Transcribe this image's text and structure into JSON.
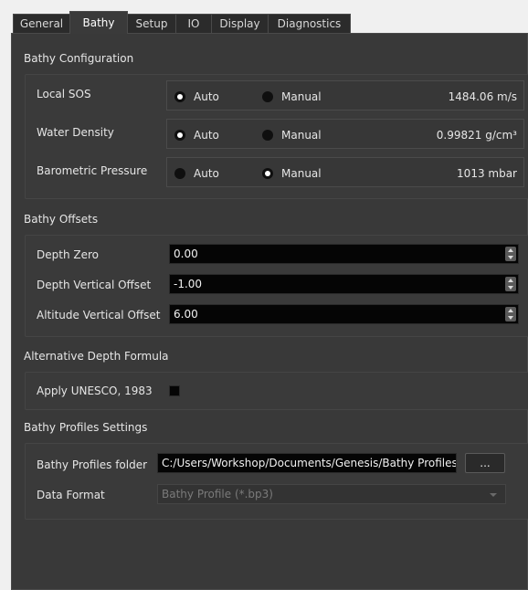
{
  "tabs": [
    "General",
    "Bathy",
    "Setup",
    "IO",
    "Display",
    "Diagnostics"
  ],
  "active_tab": "Bathy",
  "bathy_config": {
    "title": "Bathy Configuration",
    "rows": [
      {
        "label": "Local SOS",
        "auto": "Auto",
        "manual": "Manual",
        "selected": "Auto",
        "value": "1484.06 m/s"
      },
      {
        "label": "Water Density",
        "auto": "Auto",
        "manual": "Manual",
        "selected": "Auto",
        "value": "0.99821 g/cm³"
      },
      {
        "label": "Barometric Pressure",
        "auto": "Auto",
        "manual": "Manual",
        "selected": "Manual",
        "value": "1013 mbar"
      }
    ]
  },
  "bathy_offsets": {
    "title": "Bathy Offsets",
    "rows": [
      {
        "label": "Depth Zero",
        "value": "0.00"
      },
      {
        "label": "Depth Vertical Offset",
        "value": "-1.00"
      },
      {
        "label": "Altitude Vertical Offset",
        "value": "6.00"
      }
    ]
  },
  "alt_depth": {
    "title": "Alternative Depth Formula",
    "checkbox_label": "Apply UNESCO, 1983",
    "checked": false
  },
  "profiles": {
    "title": "Bathy Profiles Settings",
    "folder_label": "Bathy Profiles folder",
    "folder_value": "C:/Users/Workshop/Documents/Genesis/Bathy Profiles",
    "browse_label": "...",
    "format_label": "Data Format",
    "format_value": "Bathy Profile (*.bp3)"
  },
  "colors": {
    "panel_bg": "#393939",
    "field_bg": "#050505",
    "text": "#e6e6e6",
    "disabled_text": "#7a7a7a"
  },
  "icons": {
    "radio_selected": "radio-selected-icon",
    "radio_unselected": "radio-unselected-icon",
    "spin": "spinbox-arrows-icon",
    "dropdown": "chevron-down-icon"
  }
}
